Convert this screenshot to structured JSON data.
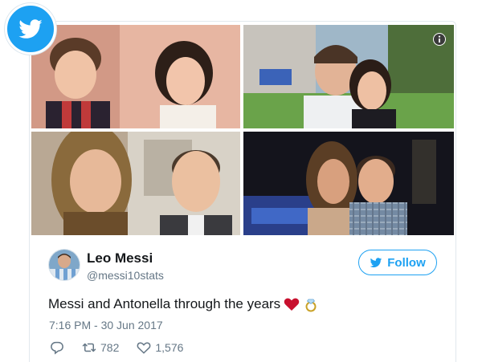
{
  "tweet": {
    "author_name": "Leo Messi",
    "author_handle": "@messi10stats",
    "follow_label": "Follow",
    "text": "Messi and Antonella through the years",
    "emojis": [
      "heart",
      "ring"
    ],
    "timestamp": "7:16 PM - 30 Jun 2017",
    "retweet_count": "782",
    "like_count": "1,576"
  },
  "icons": {
    "badge": "twitter-bird-icon",
    "info": "info-icon",
    "follow": "twitter-bird-icon",
    "reply": "reply-icon",
    "retweet": "retweet-icon",
    "like": "heart-outline-icon"
  },
  "colors": {
    "twitter_blue": "#1da1f2",
    "text": "#14171a",
    "secondary": "#657786",
    "heart": "#e0245e"
  }
}
